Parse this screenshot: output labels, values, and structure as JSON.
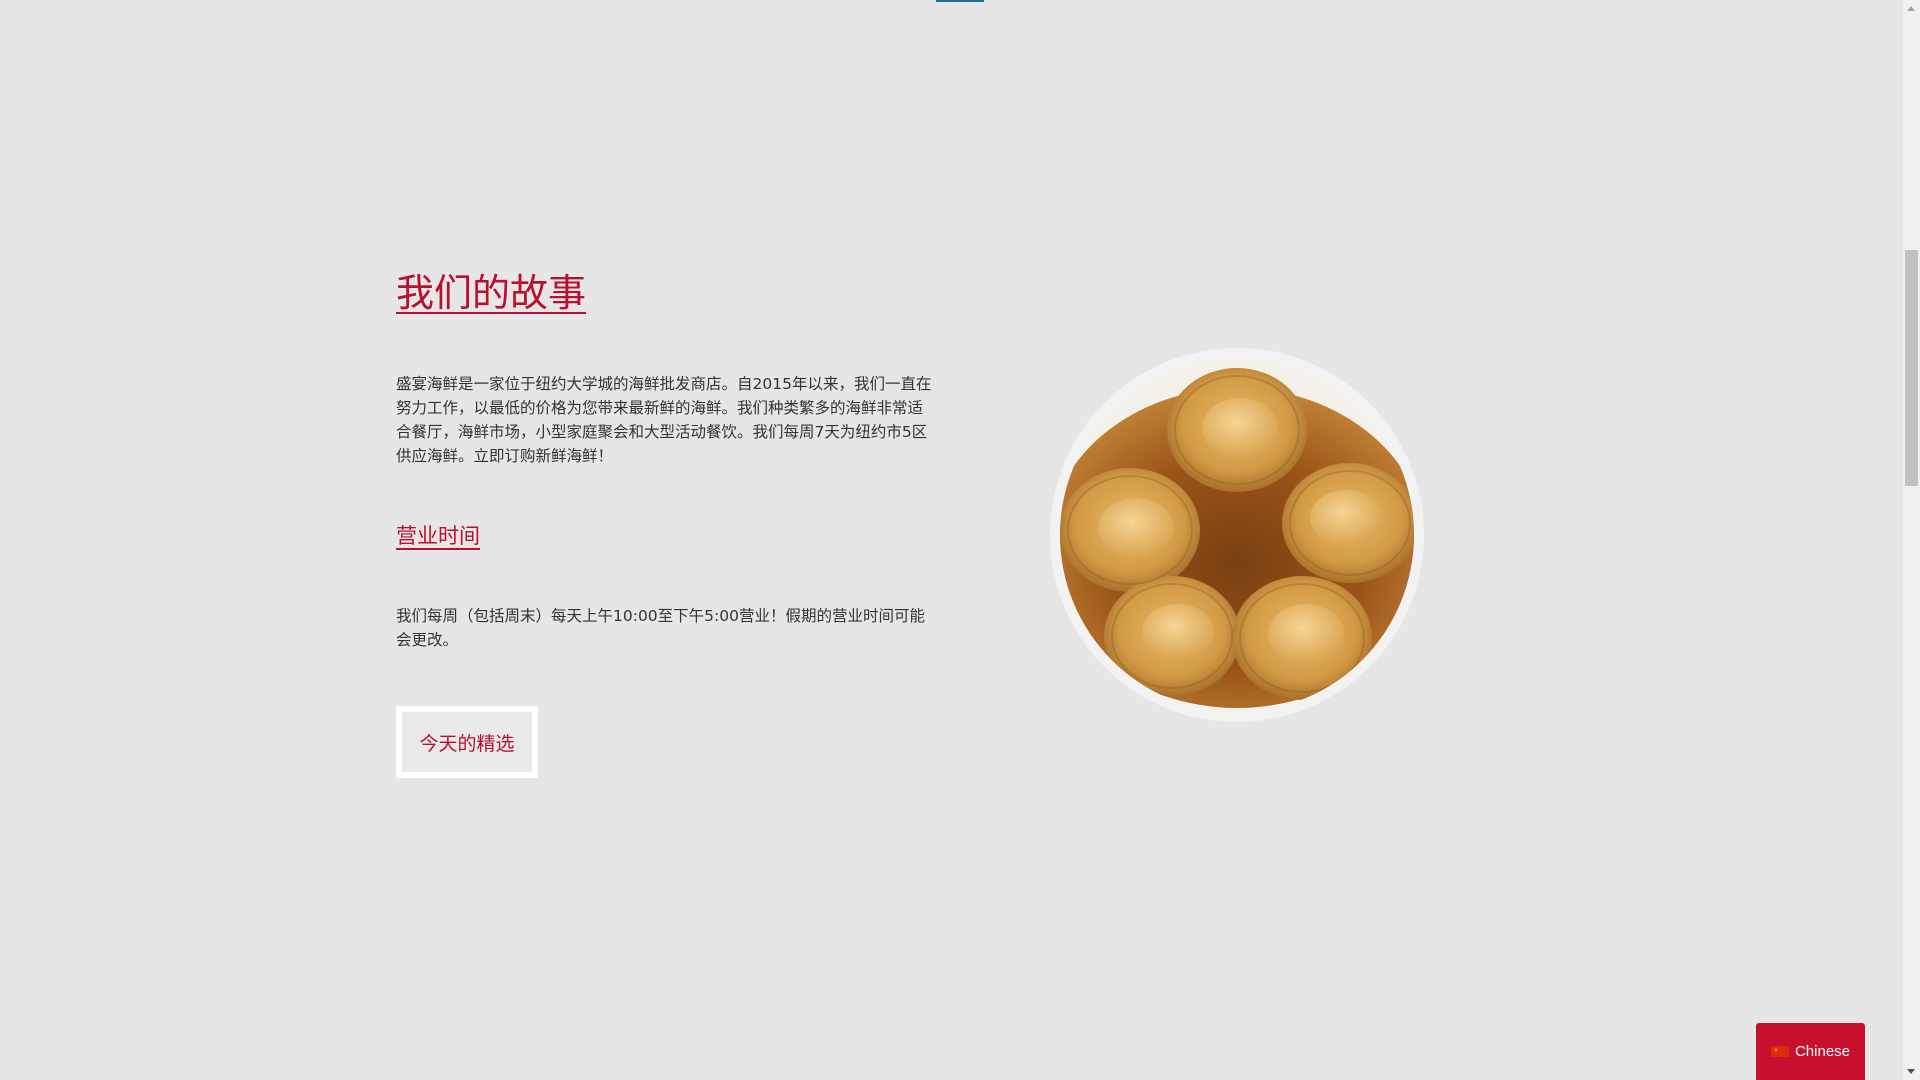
{
  "story": {
    "title": "我们的故事",
    "text": "盛宴海鲜是一家位于纽约大学城的海鲜批发商店。自2015年以来，我们一直在努力工作，以最低的价格为您带来最新鲜的海鲜。我们种类繁多的海鲜非常适合餐厅，海鲜市场，小型家庭聚会和大型活动餐饮。我们每周7天为纽约市5区供应海鲜。立即订购新鲜海鲜！"
  },
  "hours": {
    "title": "营业时间",
    "text": "我们每周（包括周末）每天上午10:00至下午5:00营业！假期的营业时间可能会更改。"
  },
  "picks_button": {
    "label": "今天的精选"
  },
  "photo": {
    "alt": "abalone dish"
  },
  "language_switcher": {
    "label": "Chinese",
    "icon": "china-flag-icon"
  },
  "colors": {
    "accent": "#b8102e",
    "background": "#e6e6e6",
    "language_button": "#c8102e"
  }
}
